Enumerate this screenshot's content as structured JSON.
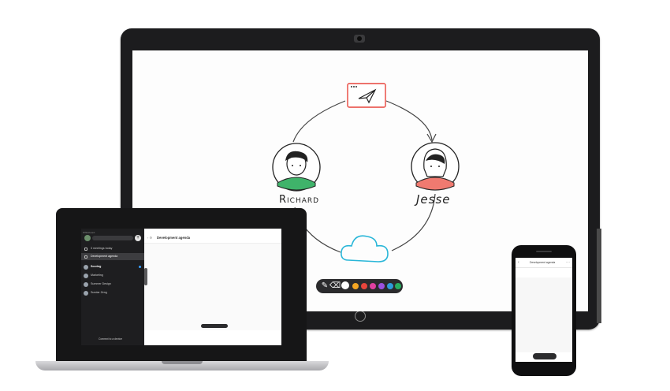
{
  "whiteboard": {
    "participants": [
      "Richard",
      "Jesse"
    ],
    "toolbar_colors": [
      "#ffffff",
      "#f5a623",
      "#e8453c",
      "#e040a0",
      "#9b51e0",
      "#2d9cdb",
      "#27ae60"
    ],
    "accent": {
      "send_card": "#e8453c",
      "cloud": "#29b6d8",
      "richard_shirt": "#27ae60",
      "jesse_shirt": "#e8453c"
    }
  },
  "laptop_app": {
    "window_title": "Whiteboard",
    "sidebar": {
      "items": [
        {
          "label": "3 meetings today"
        },
        {
          "label": "Development agenda"
        },
        {
          "label": "Scoring"
        },
        {
          "label": "Marketing"
        },
        {
          "label": "Summer Design"
        },
        {
          "label": "Sundar Zeng"
        }
      ],
      "connect_label": "Connect to a device"
    },
    "main": {
      "title": "Development agenda"
    }
  },
  "phone_app": {
    "title": "Development agenda"
  }
}
